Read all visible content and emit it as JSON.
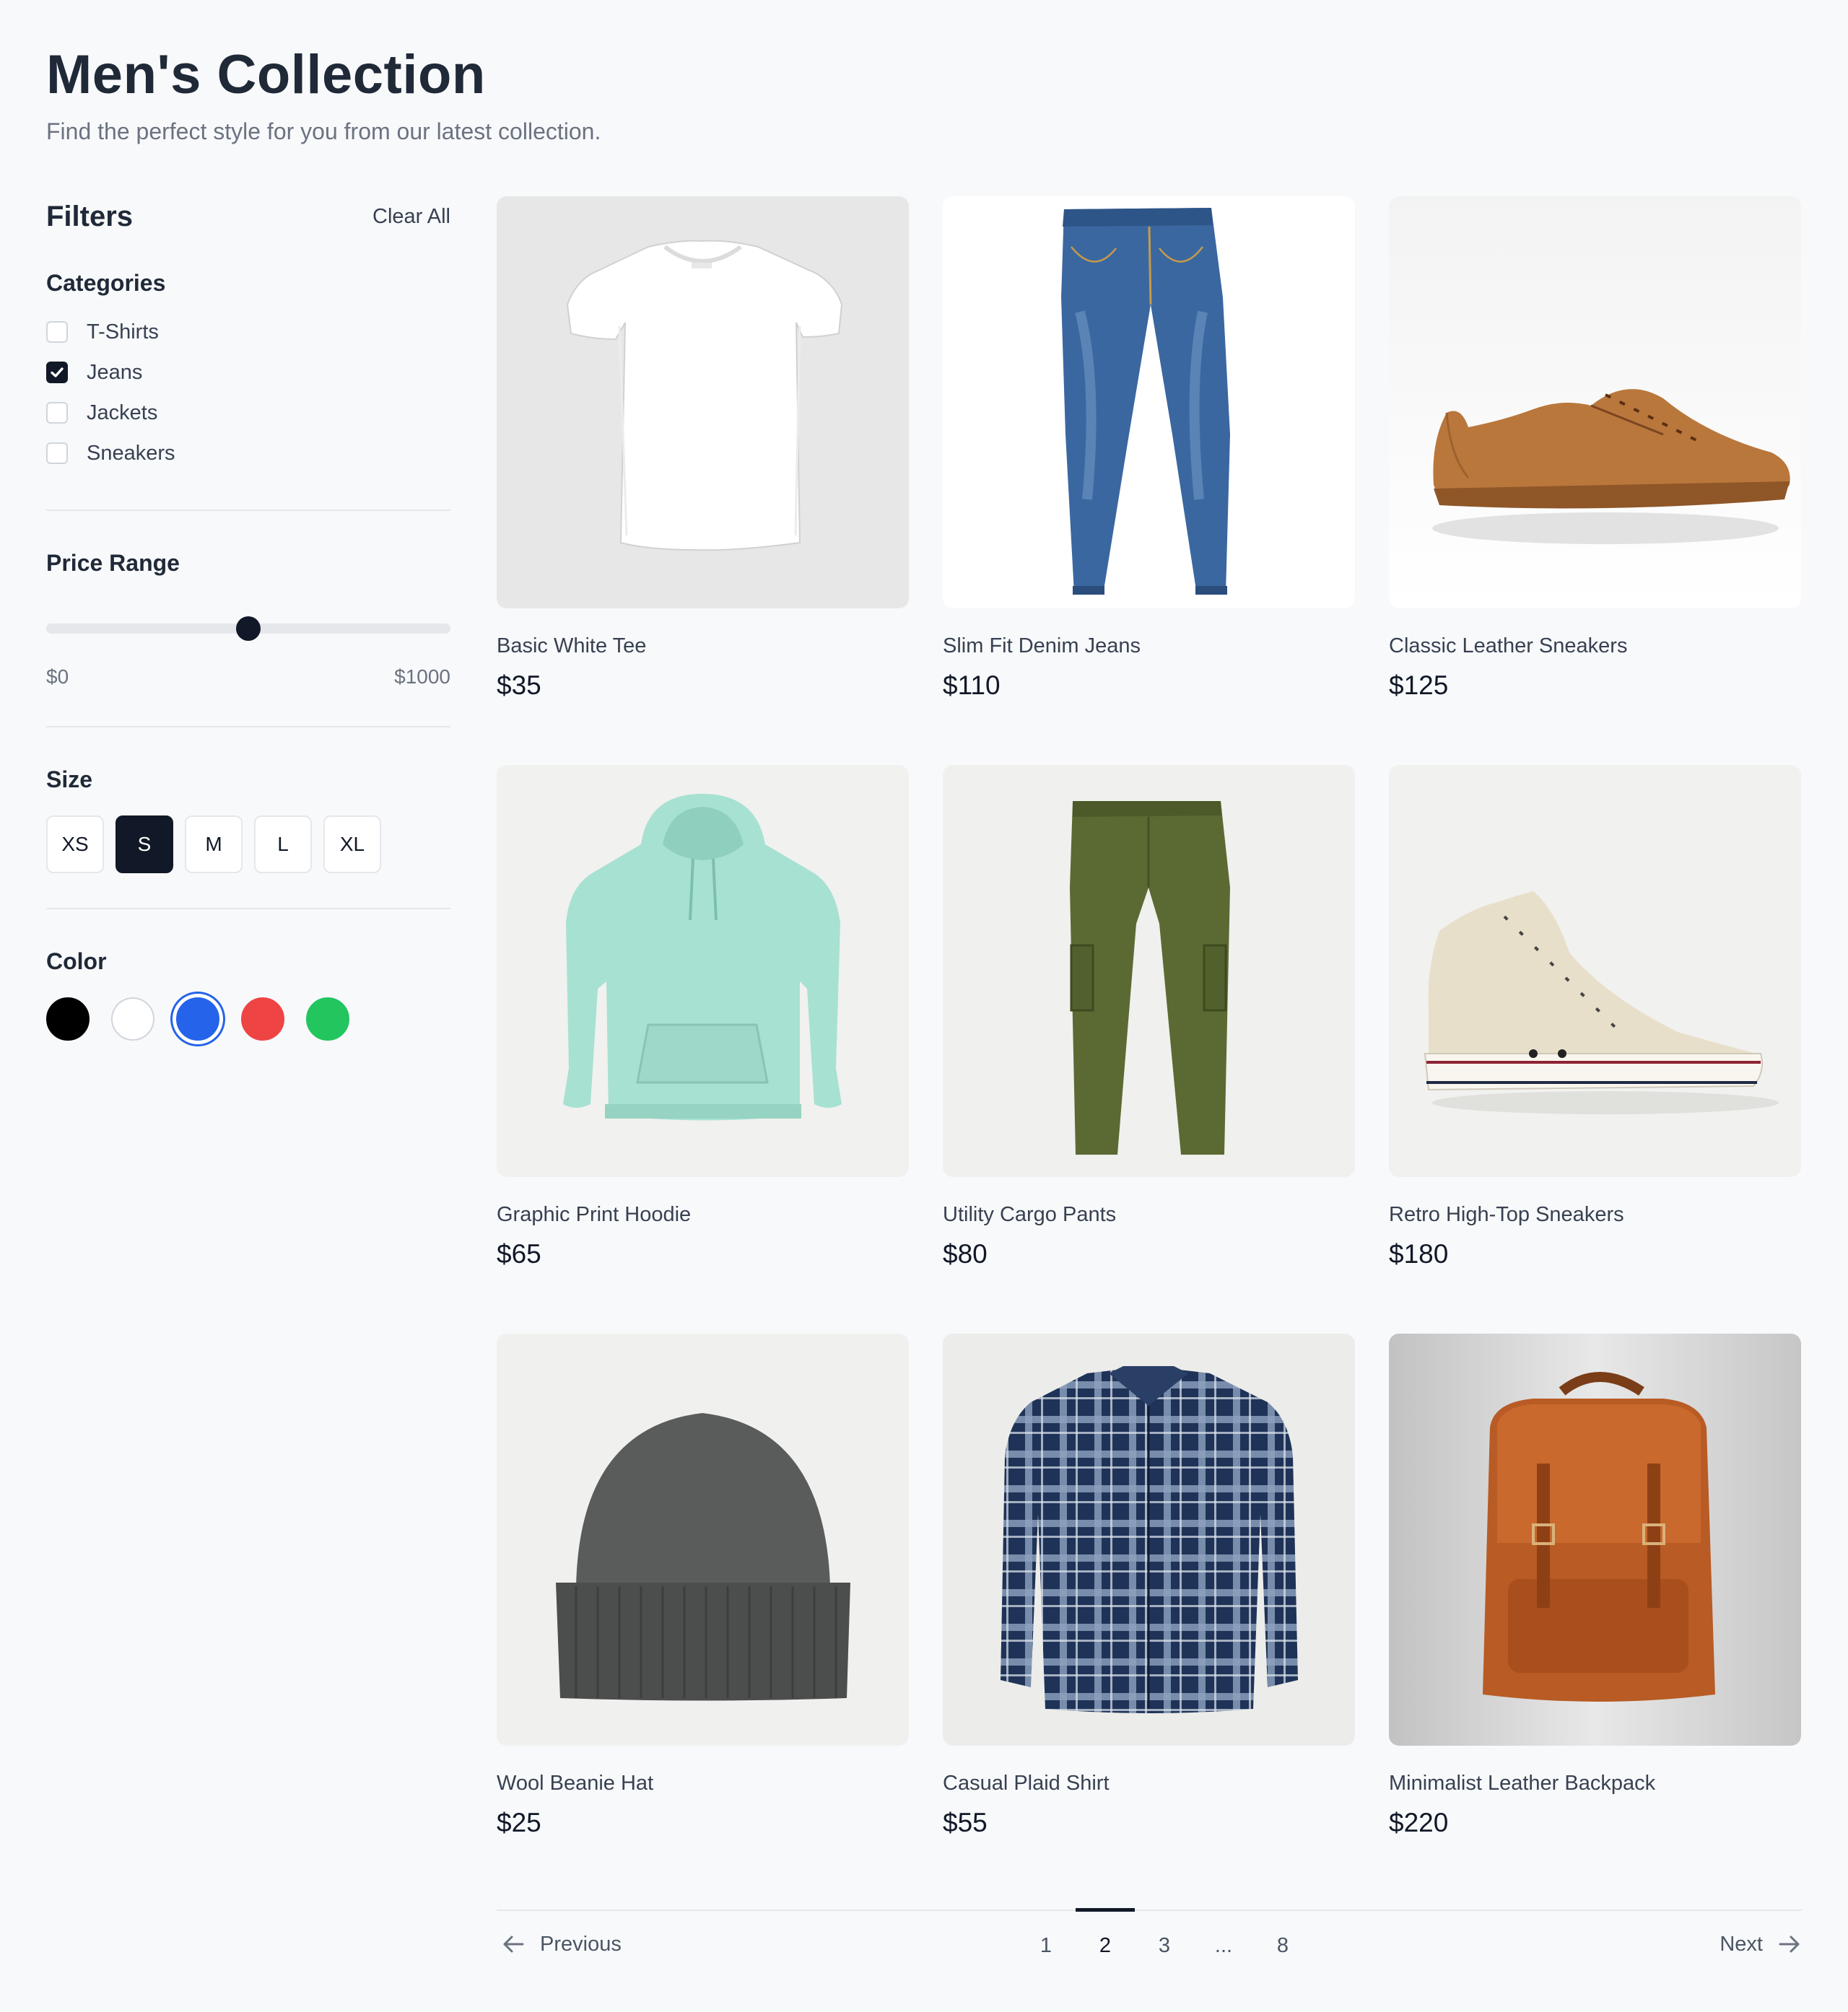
{
  "header": {
    "title": "Men's Collection",
    "subtitle": "Find the perfect style for you from our latest collection."
  },
  "filters": {
    "title": "Filters",
    "clear_all": "Clear All",
    "categories": {
      "title": "Categories",
      "items": [
        {
          "label": "T-Shirts",
          "checked": false
        },
        {
          "label": "Jeans",
          "checked": true
        },
        {
          "label": "Jackets",
          "checked": false
        },
        {
          "label": "Sneakers",
          "checked": false
        }
      ]
    },
    "price": {
      "title": "Price Range",
      "min_label": "$0",
      "max_label": "$1000",
      "value_fraction": 0.5
    },
    "size": {
      "title": "Size",
      "options": [
        "XS",
        "S",
        "M",
        "L",
        "XL"
      ],
      "selected": "S"
    },
    "color": {
      "title": "Color",
      "options": [
        "#000000",
        "#ffffff",
        "#2563eb",
        "#ef4444",
        "#22c55e"
      ],
      "selected": "#2563eb"
    }
  },
  "products": [
    {
      "name": "Basic White Tee",
      "price": "$35",
      "icon": "tshirt-image"
    },
    {
      "name": "Slim Fit Denim Jeans",
      "price": "$110",
      "icon": "jeans-image"
    },
    {
      "name": "Classic Leather Sneakers",
      "price": "$125",
      "icon": "sneaker-image"
    },
    {
      "name": "Graphic Print Hoodie",
      "price": "$65",
      "icon": "hoodie-image"
    },
    {
      "name": "Utility Cargo Pants",
      "price": "$80",
      "icon": "cargo-pants-image"
    },
    {
      "name": "Retro High-Top Sneakers",
      "price": "$180",
      "icon": "hightop-image"
    },
    {
      "name": "Wool Beanie Hat",
      "price": "$25",
      "icon": "beanie-image"
    },
    {
      "name": "Casual Plaid Shirt",
      "price": "$55",
      "icon": "plaid-shirt-image"
    },
    {
      "name": "Minimalist Leather Backpack",
      "price": "$220",
      "icon": "backpack-image"
    }
  ],
  "pagination": {
    "previous": "Previous",
    "next": "Next",
    "pages": [
      "1",
      "2",
      "3",
      "...",
      "8"
    ],
    "current": "2"
  }
}
